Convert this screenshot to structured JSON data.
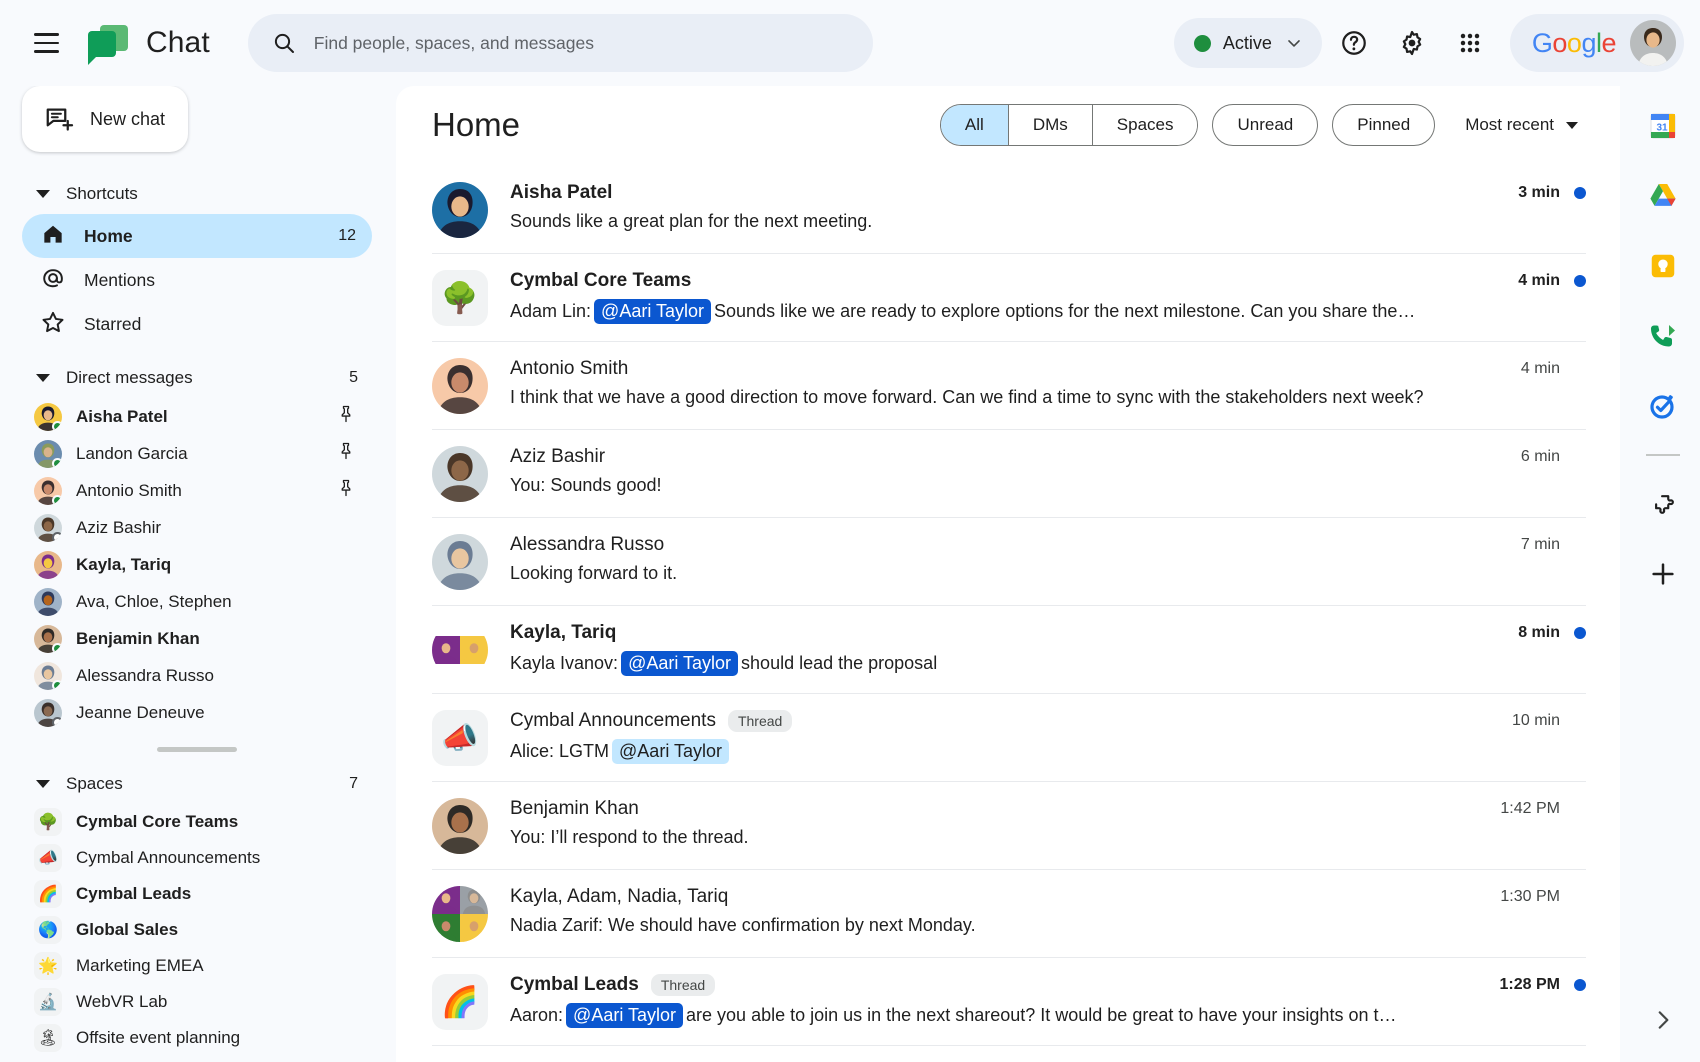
{
  "topbar": {
    "menu_icon": "hamburger-menu-icon",
    "logo_icon": "google-chat-logo",
    "title": "Chat",
    "search": {
      "placeholder": "Find people, spaces, and messages",
      "value": "",
      "icon": "search-icon"
    },
    "status": {
      "label": "Active",
      "color": "#1e8e3e",
      "caret_icon": "chevron-down-icon"
    },
    "help_icon": "help-circle-icon",
    "settings_icon": "gear-icon",
    "apps_icon": "apps-grid-icon",
    "google_logo": "Google",
    "avatar": "user-avatar"
  },
  "sidebar": {
    "new_chat": {
      "label": "New chat",
      "icon": "new-chat-icon"
    },
    "shortcuts": {
      "title": "Shortcuts",
      "items": [
        {
          "label": "Home",
          "icon": "home-icon",
          "badge": "12",
          "active": true
        },
        {
          "label": "Mentions",
          "icon": "at-sign-icon",
          "badge": "",
          "active": false
        },
        {
          "label": "Starred",
          "icon": "star-icon",
          "badge": "",
          "active": false
        }
      ]
    },
    "direct_messages": {
      "title": "Direct messages",
      "count": "5",
      "items": [
        {
          "name": "Aisha Patel",
          "unread": true,
          "pinned": true,
          "presence": "on",
          "c1": "#1a1a2e",
          "c2": "#e8b88a",
          "c3": "#f5c842"
        },
        {
          "name": "Landon Garcia",
          "unread": false,
          "pinned": true,
          "presence": "on",
          "c1": "#8a9a5b",
          "c2": "#d9b38c",
          "c3": "#6b8cae"
        },
        {
          "name": "Antonio Smith",
          "unread": false,
          "pinned": true,
          "presence": "on",
          "c1": "#3b2f2f",
          "c2": "#c98a6b",
          "c3": "#f7c9a8"
        },
        {
          "name": "Aziz Bashir",
          "unread": false,
          "pinned": false,
          "presence": "off",
          "c1": "#4a3728",
          "c2": "#8d6748",
          "c3": "#cfd8dc"
        },
        {
          "name": "Kayla, Tariq",
          "unread": true,
          "pinned": false,
          "presence": "",
          "c1": "#7b2d8b",
          "c2": "#f5c842",
          "c3": "#e8b88a"
        },
        {
          "name": "Ava, Chloe, Stephen",
          "unread": false,
          "pinned": false,
          "presence": "",
          "c1": "#2d3a5b",
          "c2": "#b5651d",
          "c3": "#9fb3c8"
        },
        {
          "name": "Benjamin Khan",
          "unread": true,
          "pinned": false,
          "presence": "on",
          "c1": "#2e2a26",
          "c2": "#a9714b",
          "c3": "#d7b899"
        },
        {
          "name": "Alessandra Russo",
          "unread": false,
          "pinned": false,
          "presence": "on",
          "c1": "#6b7c93",
          "c2": "#e8c6a0",
          "c3": "#f0e6dd"
        },
        {
          "name": "Jeanne Deneuve",
          "unread": false,
          "pinned": false,
          "presence": "off",
          "c1": "#3a2f2a",
          "c2": "#8a6a52",
          "c3": "#b9c6cf"
        }
      ]
    },
    "spaces": {
      "title": "Spaces",
      "count": "7",
      "items": [
        {
          "name": "Cymbal Core Teams",
          "emoji": "🌳",
          "unread": true
        },
        {
          "name": "Cymbal Announcements",
          "emoji": "📣",
          "unread": false
        },
        {
          "name": "Cymbal Leads",
          "emoji": "🌈",
          "unread": true
        },
        {
          "name": "Global Sales",
          "emoji": "🌎",
          "unread": true
        },
        {
          "name": "Marketing EMEA",
          "emoji": "🌟",
          "unread": false
        },
        {
          "name": "WebVR Lab",
          "emoji": "🔬",
          "unread": false
        },
        {
          "name": "Offsite event planning",
          "emoji": "🏝",
          "unread": false
        }
      ]
    }
  },
  "main": {
    "title": "Home",
    "segmented": [
      {
        "label": "All",
        "active": true
      },
      {
        "label": "DMs",
        "active": false
      },
      {
        "label": "Spaces",
        "active": false
      }
    ],
    "pills": [
      {
        "label": "Unread"
      },
      {
        "label": "Pinned"
      }
    ],
    "sort": {
      "label": "Most recent",
      "caret_icon": "chevron-down-icon"
    },
    "conversations": [
      {
        "name": "Aisha Patel",
        "unread": true,
        "thread": false,
        "time": "3 min",
        "avatar_type": "photo",
        "colors": [
          "#1a1a2e",
          "#e8b88a",
          "#1d6fa5"
        ],
        "prefix": "",
        "mention": "",
        "mention_style": "",
        "text": "Sounds like a great plan for the next meeting."
      },
      {
        "name": "Cymbal Core Teams",
        "unread": true,
        "thread": false,
        "time": "4 min",
        "avatar_type": "space",
        "emoji": "🌳",
        "prefix": "Adam Lin:",
        "mention": "@Aari Taylor",
        "mention_style": "strong",
        "text": "Sounds like we are ready to explore options for the next milestone. Can you share the…"
      },
      {
        "name": "Antonio Smith",
        "unread": false,
        "thread": false,
        "time": "4 min",
        "avatar_type": "photo",
        "colors": [
          "#3b2f2f",
          "#c98a6b",
          "#f7c9a8"
        ],
        "prefix": "",
        "mention": "",
        "mention_style": "",
        "text": "I think that we have a good direction to move forward. Can we find a time to sync with the stakeholders next week?"
      },
      {
        "name": "Aziz Bashir",
        "unread": false,
        "thread": false,
        "time": "6 min",
        "avatar_type": "photo",
        "colors": [
          "#4a3728",
          "#8d6748",
          "#cfd8dc"
        ],
        "prefix": "",
        "mention": "",
        "mention_style": "",
        "text": "You: Sounds good!"
      },
      {
        "name": "Alessandra Russo",
        "unread": false,
        "thread": false,
        "time": "7 min",
        "avatar_type": "photo",
        "colors": [
          "#6b7c93",
          "#e8c6a0",
          "#cfd8dc"
        ],
        "prefix": "",
        "mention": "",
        "mention_style": "",
        "text": "Looking forward to it."
      },
      {
        "name": "Kayla, Tariq",
        "unread": true,
        "thread": false,
        "time": "8 min",
        "avatar_type": "grid2",
        "colors": [
          "#7b2d8b",
          "#f5c842"
        ],
        "prefix": "Kayla Ivanov:",
        "mention": "@Aari Taylor",
        "mention_style": "strong",
        "text": "should lead the proposal"
      },
      {
        "name": "Cymbal Announcements",
        "unread": false,
        "thread": true,
        "thread_label": "Thread",
        "time": "10 min",
        "avatar_type": "space",
        "emoji": "📣",
        "prefix": "Alice: LGTM",
        "mention": "@Aari Taylor",
        "mention_style": "light",
        "text": ""
      },
      {
        "name": "Benjamin Khan",
        "unread": false,
        "thread": false,
        "time": "1:42 PM",
        "avatar_type": "photo",
        "colors": [
          "#2e2a26",
          "#a9714b",
          "#d7b899"
        ],
        "prefix": "",
        "mention": "",
        "mention_style": "",
        "text": "You: I’ll respond to the thread."
      },
      {
        "name": "Kayla, Adam, Nadia, Tariq",
        "unread": false,
        "thread": false,
        "time": "1:30 PM",
        "avatar_type": "grid4",
        "colors": [
          "#7b2d8b",
          "#8d8d8d",
          "#2e7d32",
          "#f5c842"
        ],
        "prefix": "",
        "mention": "",
        "mention_style": "",
        "text": "Nadia Zarif: We should have confirmation by next Monday."
      },
      {
        "name": "Cymbal Leads",
        "unread": true,
        "thread": true,
        "thread_label": "Thread",
        "time": "1:28 PM",
        "avatar_type": "space",
        "emoji": "🌈",
        "prefix": "Aaron:",
        "mention": "@Aari Taylor",
        "mention_style": "strong",
        "text": "are you able to join us in the next shareout? It would be great to have your insights on t…"
      }
    ]
  },
  "rail": {
    "items": [
      {
        "icon": "google-calendar-icon",
        "name": "calendar"
      },
      {
        "icon": "google-drive-icon",
        "name": "drive"
      },
      {
        "icon": "google-keep-icon",
        "name": "keep"
      },
      {
        "icon": "google-voice-icon",
        "name": "voice"
      },
      {
        "icon": "google-tasks-icon",
        "name": "tasks"
      }
    ],
    "addon_icon": "puzzle-piece-icon",
    "add_icon": "plus-icon",
    "expand_icon": "chevron-right-icon"
  }
}
